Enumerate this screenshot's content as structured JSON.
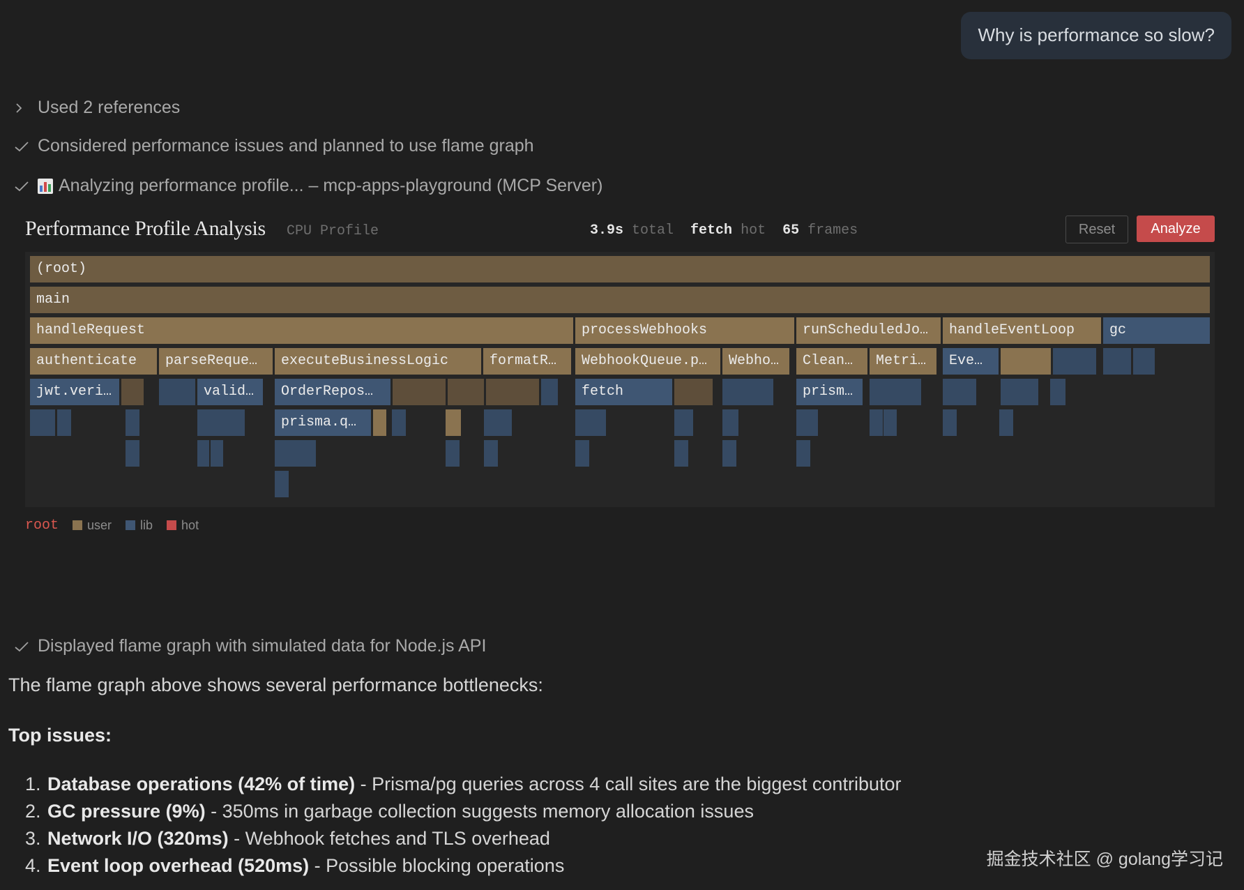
{
  "user_message": "Why is performance so slow?",
  "steps": {
    "references": "Used 2 references",
    "considered": "Considered performance issues and planned to use flame graph",
    "analyzing": "Analyzing performance profile... – mcp-apps-playground (MCP Server)",
    "displayed": "Displayed flame graph with simulated data for Node.js API"
  },
  "widget": {
    "title": "Performance Profile Analysis",
    "subtitle": "CPU Profile",
    "stats": {
      "total_value": "3.9s",
      "total_label": "total",
      "hot_value": "fetch",
      "hot_label": "hot",
      "frames_value": "65",
      "frames_label": "frames"
    },
    "reset_label": "Reset",
    "analyze_label": "Analyze",
    "frames": [
      {
        "label": "(root)"
      },
      {
        "label": "main"
      },
      {
        "label": "handleRequest"
      },
      {
        "label": "processWebhooks"
      },
      {
        "label": "runScheduledJo…"
      },
      {
        "label": "handleEventLoop"
      },
      {
        "label": "gc"
      },
      {
        "label": "authenticate"
      },
      {
        "label": "parseReque…"
      },
      {
        "label": "executeBusinessLogic"
      },
      {
        "label": "formatR…"
      },
      {
        "label": "WebhookQueue.p…"
      },
      {
        "label": "Webho…"
      },
      {
        "label": "Clean…"
      },
      {
        "label": "Metri…"
      },
      {
        "label": "Eve…"
      },
      {
        "label": "jwt.veri…"
      },
      {
        "label": "valid…"
      },
      {
        "label": "OrderRepos…"
      },
      {
        "label": "fetch"
      },
      {
        "label": "prism…"
      },
      {
        "label": "prisma.q…"
      }
    ],
    "legend": {
      "root": "root",
      "user": "user",
      "lib": "lib",
      "hot": "hot",
      "colors": {
        "user": "#8a7350",
        "lib": "#3f5673",
        "hot": "#c54b4b"
      }
    }
  },
  "response": {
    "intro": "The flame graph above shows several performance bottlenecks:",
    "top_issues_heading": "Top issues:",
    "issues": [
      {
        "num": "1.",
        "title": "Database operations (42% of time)",
        "desc": " - Prisma/pg queries across 4 call sites are the biggest contributor"
      },
      {
        "num": "2.",
        "title": "GC pressure (9%)",
        "desc": " - 350ms in garbage collection suggests memory allocation issues"
      },
      {
        "num": "3.",
        "title": "Network I/O (320ms)",
        "desc": " - Webhook fetches and TLS overhead"
      },
      {
        "num": "4.",
        "title": "Event loop overhead (520ms)",
        "desc": " - Possible blocking operations"
      }
    ]
  },
  "watermark": "掘金技术社区 @ golang学习记"
}
